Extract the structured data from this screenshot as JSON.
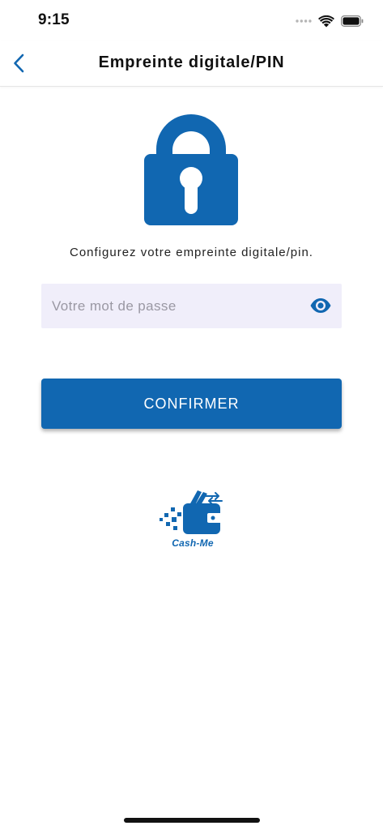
{
  "status_bar": {
    "time": "9:15"
  },
  "nav": {
    "back_icon": "chevron-left-icon",
    "title": "Empreinte digitale/PIN"
  },
  "lock": {
    "icon": "padlock-icon"
  },
  "instruction": "Configurez votre empreinte digitale/pin.",
  "password": {
    "placeholder": "Votre mot de passe",
    "value": "",
    "toggle_icon": "eye-icon"
  },
  "confirm_label": "CONFIRMER",
  "logo": {
    "icon": "wallet-icon",
    "text": "Cash-Me"
  },
  "colors": {
    "primary": "#1167b1",
    "input_bg": "#f0eefa",
    "text": "#111111"
  }
}
